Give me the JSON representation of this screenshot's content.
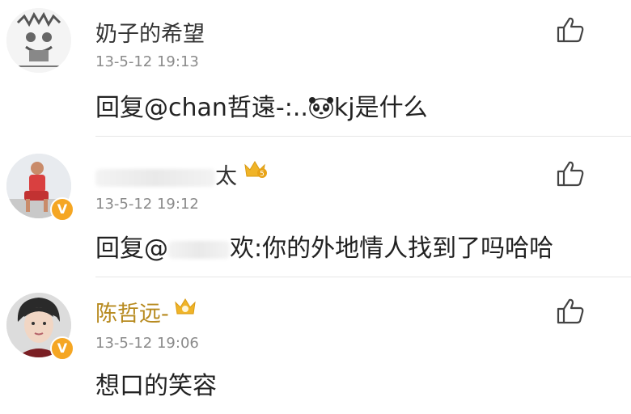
{
  "comments": [
    {
      "username": "奶子的希望",
      "time": "13-5-12 19:13",
      "text_prefix": "回复@chan哲遠-:..",
      "text_suffix": "kj是什么",
      "avatar": "sketch-avatar",
      "badge": ""
    },
    {
      "username_partial": "太",
      "time": "13-5-12 19:12",
      "text_prefix": "回复@",
      "text_suffix": "欢:你的外地情人找到了吗哈哈",
      "avatar": "photo-avatar",
      "badge": "5"
    },
    {
      "username": "陈哲远-",
      "time": "13-5-12 19:06",
      "text": "想口的笑容",
      "avatar": "portrait-avatar",
      "badge": ""
    }
  ],
  "colors": {
    "vip_name": "#b78a1f",
    "badge": "#f5a623",
    "crown": "#f0b428"
  },
  "icons": [
    "thumbs-up-icon",
    "crown-icon",
    "verified-badge-icon",
    "panda-emoji-icon"
  ]
}
